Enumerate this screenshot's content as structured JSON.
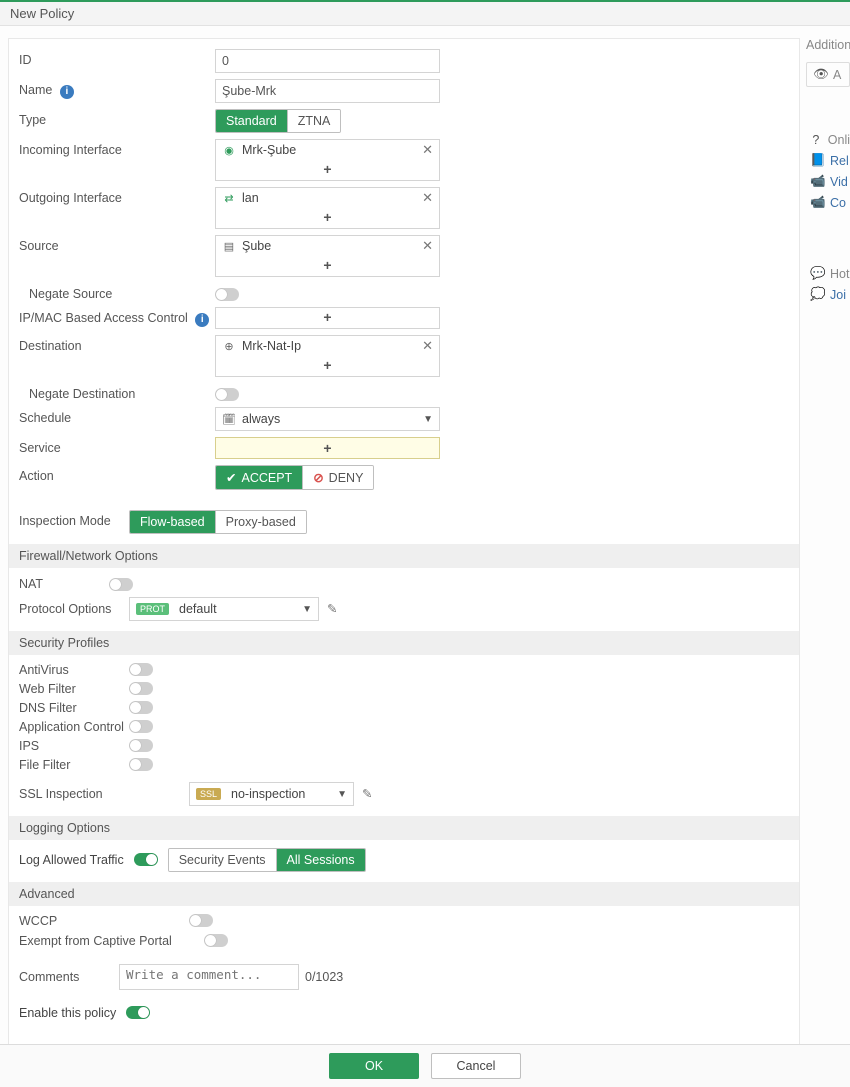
{
  "header": {
    "title": "New Policy"
  },
  "fields": {
    "id_label": "ID",
    "id_value": "0",
    "name_label": "Name",
    "name_value": "Şube-Mrk",
    "type_label": "Type",
    "type_options": {
      "standard": "Standard",
      "ztna": "ZTNA"
    },
    "incoming_label": "Incoming Interface",
    "incoming_item": "Mrk-Şube",
    "outgoing_label": "Outgoing Interface",
    "outgoing_item": "lan",
    "source_label": "Source",
    "source_item": "Şube",
    "negate_source_label": "Negate Source",
    "ipmac_label": "IP/MAC Based Access Control",
    "destination_label": "Destination",
    "destination_item": "Mrk-Nat-Ip",
    "negate_destination_label": "Negate Destination",
    "schedule_label": "Schedule",
    "schedule_value": "always",
    "service_label": "Service",
    "action_label": "Action",
    "action_accept": "ACCEPT",
    "action_deny": "DENY",
    "inspection_label": "Inspection Mode",
    "inspection_flow": "Flow-based",
    "inspection_proxy": "Proxy-based",
    "plus": "+"
  },
  "sections": {
    "fwnet": "Firewall/Network Options",
    "sec": "Security Profiles",
    "log": "Logging Options",
    "adv": "Advanced"
  },
  "fwnet": {
    "nat_label": "NAT",
    "proto_label": "Protocol Options",
    "proto_badge": "PROT",
    "proto_value": "default"
  },
  "sec": {
    "av": "AntiVirus",
    "wf": "Web Filter",
    "dns": "DNS Filter",
    "app": "Application Control",
    "ips": "IPS",
    "ff": "File Filter",
    "ssl_label": "SSL Inspection",
    "ssl_badge": "SSL",
    "ssl_value": "no-inspection"
  },
  "log": {
    "allowed_label": "Log Allowed Traffic",
    "sec_events": "Security Events",
    "all_sessions": "All Sessions"
  },
  "adv": {
    "wccp": "WCCP",
    "exempt": "Exempt from Captive Portal",
    "comments_label": "Comments",
    "comments_placeholder": "Write a comment...",
    "char_count": "0/1023",
    "enable": "Enable this policy"
  },
  "buttons": {
    "ok": "OK",
    "cancel": "Cancel"
  },
  "side": {
    "additional": "Addition",
    "a": "A",
    "online": "Onli",
    "rel": "Rel",
    "vid": "Vid",
    "con": "Co",
    "hot": "Hot",
    "join": "Joi"
  }
}
